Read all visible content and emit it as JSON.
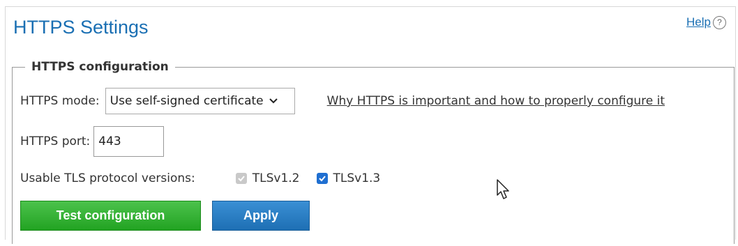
{
  "header": {
    "title": "HTTPS Settings",
    "help_label": "Help",
    "help_icon_glyph": "?"
  },
  "config": {
    "legend": "HTTPS configuration",
    "mode_label": "HTTPS mode:",
    "mode_value": "Use self-signed certificate",
    "info_link": "Why HTTPS is important and how to properly configure it",
    "port_label": "HTTPS port:",
    "port_value": "443",
    "tls_label": "Usable TLS protocol versions:",
    "tls_options": [
      {
        "label": "TLSv1.2",
        "checked": true,
        "disabled": true
      },
      {
        "label": "TLSv1.3",
        "checked": true,
        "disabled": false
      }
    ]
  },
  "buttons": {
    "test_label": "Test configuration",
    "apply_label": "Apply"
  },
  "colors": {
    "title": "#1a6fb3",
    "test_button": "#22a322",
    "apply_button": "#1e6fb4",
    "checkbox_checked": "#1f6fd1"
  }
}
